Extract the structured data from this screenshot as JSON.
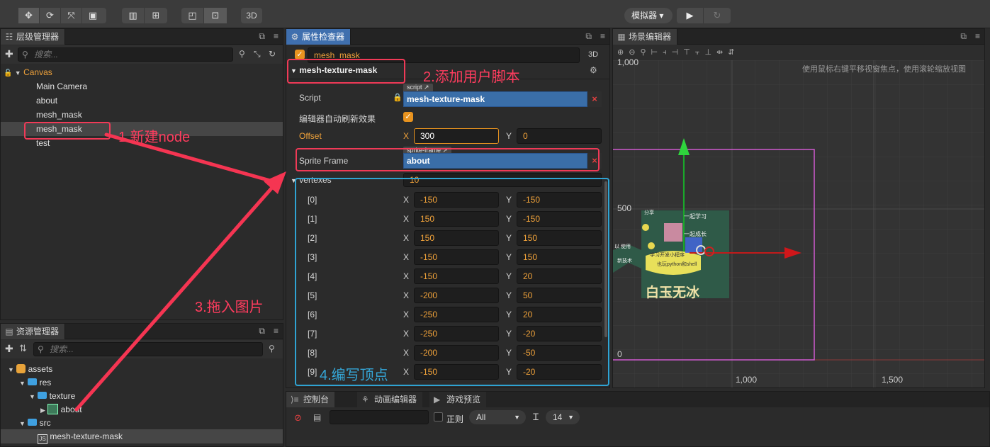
{
  "toolbar": {
    "simulator_label": "模拟器 ▾",
    "btn_3d": "3D"
  },
  "hierarchy": {
    "tab_title": "层级管理器",
    "search_placeholder": "搜索...",
    "root": "Canvas",
    "items": [
      "Main Camera",
      "about",
      "mesh_mask",
      "mesh_mask",
      "test"
    ]
  },
  "assets": {
    "tab_title": "资源管理器",
    "search_placeholder": "搜索...",
    "items": [
      {
        "label": "assets"
      },
      {
        "label": "res"
      },
      {
        "label": "texture"
      },
      {
        "label": "about"
      },
      {
        "label": "src"
      },
      {
        "label": "mesh-texture-mask"
      }
    ]
  },
  "inspector": {
    "tab_title": "属性检查器",
    "node_name": "mesh_mask",
    "btn_3d": "3D",
    "component_title": "mesh-texture-mask",
    "script_label": "Script",
    "script_tag": "script ↗",
    "script_value": "mesh-texture-mask",
    "auto_refresh_label": "编辑器自动刷新效果",
    "offset_label": "Offset",
    "offset_x": "300",
    "offset_y": "0",
    "sprite_frame_label": "Sprite Frame",
    "sprite_frame_tag": "sprite-frame ↗",
    "sprite_frame_value": "about",
    "vertexes_label": "vertexes",
    "vertexes_count": "10",
    "axis_x": "X",
    "axis_y": "Y",
    "vertexes": [
      {
        "index": "[0]",
        "x": "-150",
        "y": "-150"
      },
      {
        "index": "[1]",
        "x": "150",
        "y": "-150"
      },
      {
        "index": "[2]",
        "x": "150",
        "y": "150"
      },
      {
        "index": "[3]",
        "x": "-150",
        "y": "150"
      },
      {
        "index": "[4]",
        "x": "-150",
        "y": "20"
      },
      {
        "index": "[5]",
        "x": "-200",
        "y": "50"
      },
      {
        "index": "[6]",
        "x": "-250",
        "y": "20"
      },
      {
        "index": "[7]",
        "x": "-250",
        "y": "-20"
      },
      {
        "index": "[8]",
        "x": "-200",
        "y": "-50"
      },
      {
        "index": "[9]",
        "x": "-150",
        "y": "-20"
      }
    ]
  },
  "scene": {
    "tab_title": "场景编辑器",
    "hint": "使用鼠标右键平移视窗焦点，使用滚轮缩放视图",
    "label_1000_top": "1,000",
    "label_500": "500",
    "label_0": "0",
    "label_1000_bottom": "1,000",
    "label_1500": "1,500",
    "image_texts": {
      "line1": "一起学习",
      "line2": "一起成长",
      "bubble1": "学习开发小程序",
      "bubble2": "也玩python和shell",
      "bottom": "白玉无冰",
      "left1": "以 使用",
      "left2": "新技术",
      "top_left": "分享"
    }
  },
  "console": {
    "tab_console": "控制台",
    "tab_animation": "动画编辑器",
    "tab_preview": "游戏预览",
    "regex_label": "正则",
    "level_select": "All",
    "font_size": "14"
  },
  "annotations": {
    "a1": "1.新建node",
    "a2": "2.添加用户脚本",
    "a3": "3.拖入图片",
    "a4": "4.编写顶点"
  }
}
